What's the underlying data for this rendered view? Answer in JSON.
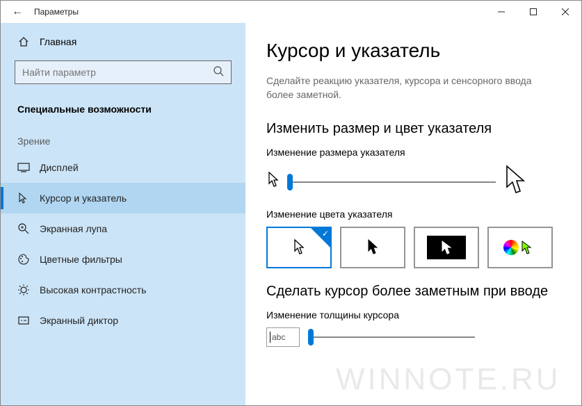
{
  "window": {
    "title": "Параметры"
  },
  "sidebar": {
    "home_label": "Главная",
    "search_placeholder": "Найти параметр",
    "section": "Специальные возможности",
    "group": "Зрение",
    "items": [
      {
        "label": "Дисплей"
      },
      {
        "label": "Курсор и указатель"
      },
      {
        "label": "Экранная лупа"
      },
      {
        "label": "Цветные фильтры"
      },
      {
        "label": "Высокая контрастность"
      },
      {
        "label": "Экранный диктор"
      }
    ]
  },
  "main": {
    "heading": "Курсор и указатель",
    "description": "Сделайте реакцию указателя, курсора и сенсорного ввода более заметной.",
    "section1_heading": "Изменить размер и цвет указателя",
    "size_label": "Изменение размера указателя",
    "color_label": "Изменение цвета указателя",
    "section2_heading": "Сделать курсор более заметным при вводе",
    "thickness_label": "Изменение толщины курсора",
    "preview_text": "abc"
  },
  "watermark": "WINNOTE.RU"
}
